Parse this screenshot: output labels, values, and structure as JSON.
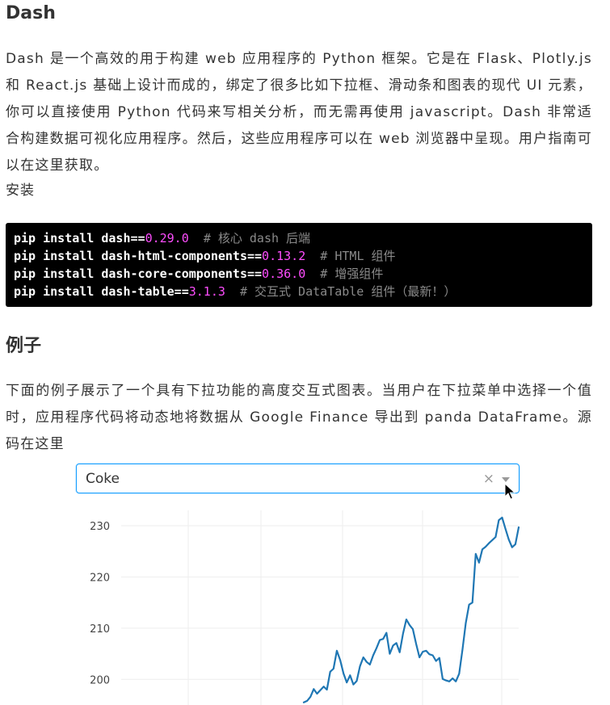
{
  "heading_dash": "Dash",
  "paragraph_intro": "Dash 是一个高效的用于构建 web 应用程序的 Python 框架。它是在 Flask、Plotly.js 和 React.js 基础上设计而成的，绑定了很多比如下拉框、滑动条和图表的现代 UI 元素，你可以直接使用 Python 代码来写相关分析，而无需再使用 javascript。Dash 非常适合构建数据可视化应用程序。然后，这些应用程序可以在 web 浏览器中呈现。用户指南可以在这里获取。",
  "label_install": "安装",
  "code_lines": [
    {
      "cmd": "pip install dash==",
      "num": "0.29.0",
      "pad": "  ",
      "comment": "# 核心 dash 后端"
    },
    {
      "cmd": "pip install dash-html-components==",
      "num": "0.13.2",
      "pad": "  ",
      "comment": "# HTML 组件"
    },
    {
      "cmd": "pip install dash-core-components==",
      "num": "0.36.0",
      "pad": "  ",
      "comment": "# 增强组件"
    },
    {
      "cmd": "pip install dash-table==",
      "num": "3.1.3",
      "pad": "  ",
      "comment": "# 交互式 DataTable 组件（最新！）"
    }
  ],
  "heading_example": "例子",
  "paragraph_example": "下面的例子展示了一个具有下拉功能的高度交互式图表。当用户在下拉菜单中选择一个值时，应用程序代码将动态地将数据从 Google Finance 导出到 panda DataFrame。源码在这里",
  "dropdown": {
    "value": "Coke",
    "clear_symbol": "×"
  },
  "colors": {
    "line": "#1f77b4",
    "dropdown_border": "#119dff",
    "code_bg": "#000000",
    "code_number": "#ff4dff",
    "code_comment": "#8a8a8a"
  },
  "chart_data": {
    "type": "line",
    "yticks": [
      200,
      210,
      220,
      230
    ],
    "ylim": [
      195,
      233
    ],
    "grid": true,
    "series": [
      {
        "values": [
          195.5,
          195.8,
          196.6,
          198.1,
          197.2,
          197.9,
          198.6,
          198.0,
          201.5,
          202.1,
          205.6,
          203.8,
          201.2,
          199.4,
          200.8,
          199.0,
          199.7,
          202.6,
          204.3,
          203.4,
          202.9,
          204.7,
          206.1,
          207.7,
          207.9,
          209.1,
          205.0,
          206.6,
          207.1,
          205.3,
          208.9,
          211.7,
          210.6,
          209.8,
          206.9,
          204.3,
          205.4,
          205.6,
          204.9,
          204.7,
          203.6,
          204.2,
          200.1,
          199.8,
          199.6,
          200.2,
          199.6,
          201.1,
          205.8,
          211.0,
          214.6,
          215.0,
          224.5,
          222.8,
          225.4,
          225.9,
          226.6,
          227.2,
          227.8,
          231.1,
          231.6,
          229.4,
          227.3,
          225.8,
          226.4,
          229.7
        ]
      }
    ]
  }
}
